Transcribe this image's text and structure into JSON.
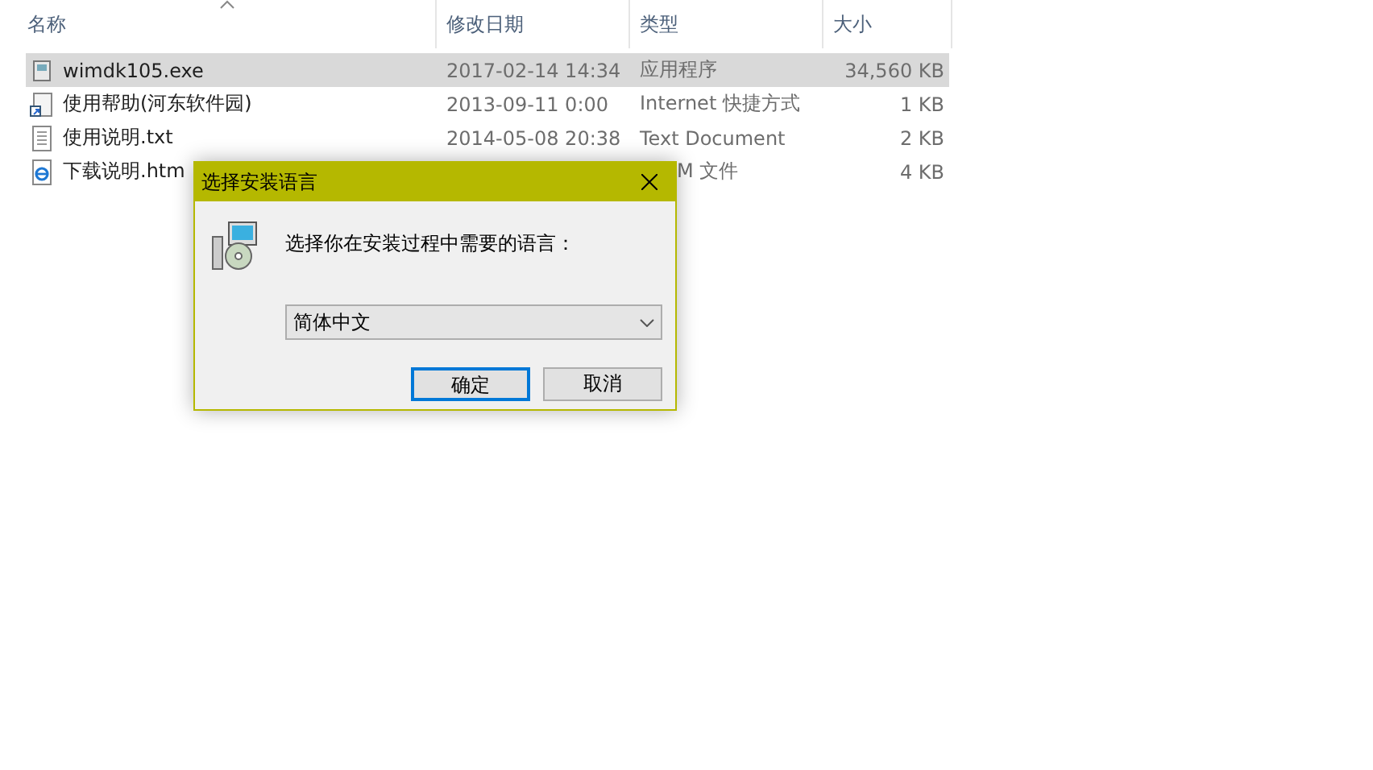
{
  "file_list": {
    "columns": [
      {
        "label": "名称",
        "sorted": true
      },
      {
        "label": "修改日期",
        "sorted": false
      },
      {
        "label": "类型",
        "sorted": false
      },
      {
        "label": "大小",
        "sorted": false
      }
    ],
    "rows": [
      {
        "kind": "exe",
        "name": "wimdk105.exe",
        "date": "2017-02-14 14:34",
        "type": "应用程序",
        "size": "34,560 KB",
        "selected": true
      },
      {
        "kind": "shortcut",
        "name": "使用帮助(河东软件园)",
        "date": "2013-09-11 0:00",
        "type": "Internet 快捷方式",
        "size": "1 KB",
        "selected": false
      },
      {
        "kind": "text",
        "name": "使用说明.txt",
        "date": "2014-05-08 20:38",
        "type": "Text Document",
        "size": "2 KB",
        "selected": false
      },
      {
        "kind": "web",
        "name": "下载说明.htm",
        "type": "M 文件",
        "size": "4 KB",
        "selected": false,
        "type_partial": true
      }
    ]
  },
  "dialog": {
    "title": "选择安装语言",
    "prompt": "选择你在安装过程中需要的语言：",
    "language": "简体中文",
    "buttons": [
      {
        "label": "确定",
        "default": true
      },
      {
        "label": "取消",
        "default": false
      }
    ]
  }
}
